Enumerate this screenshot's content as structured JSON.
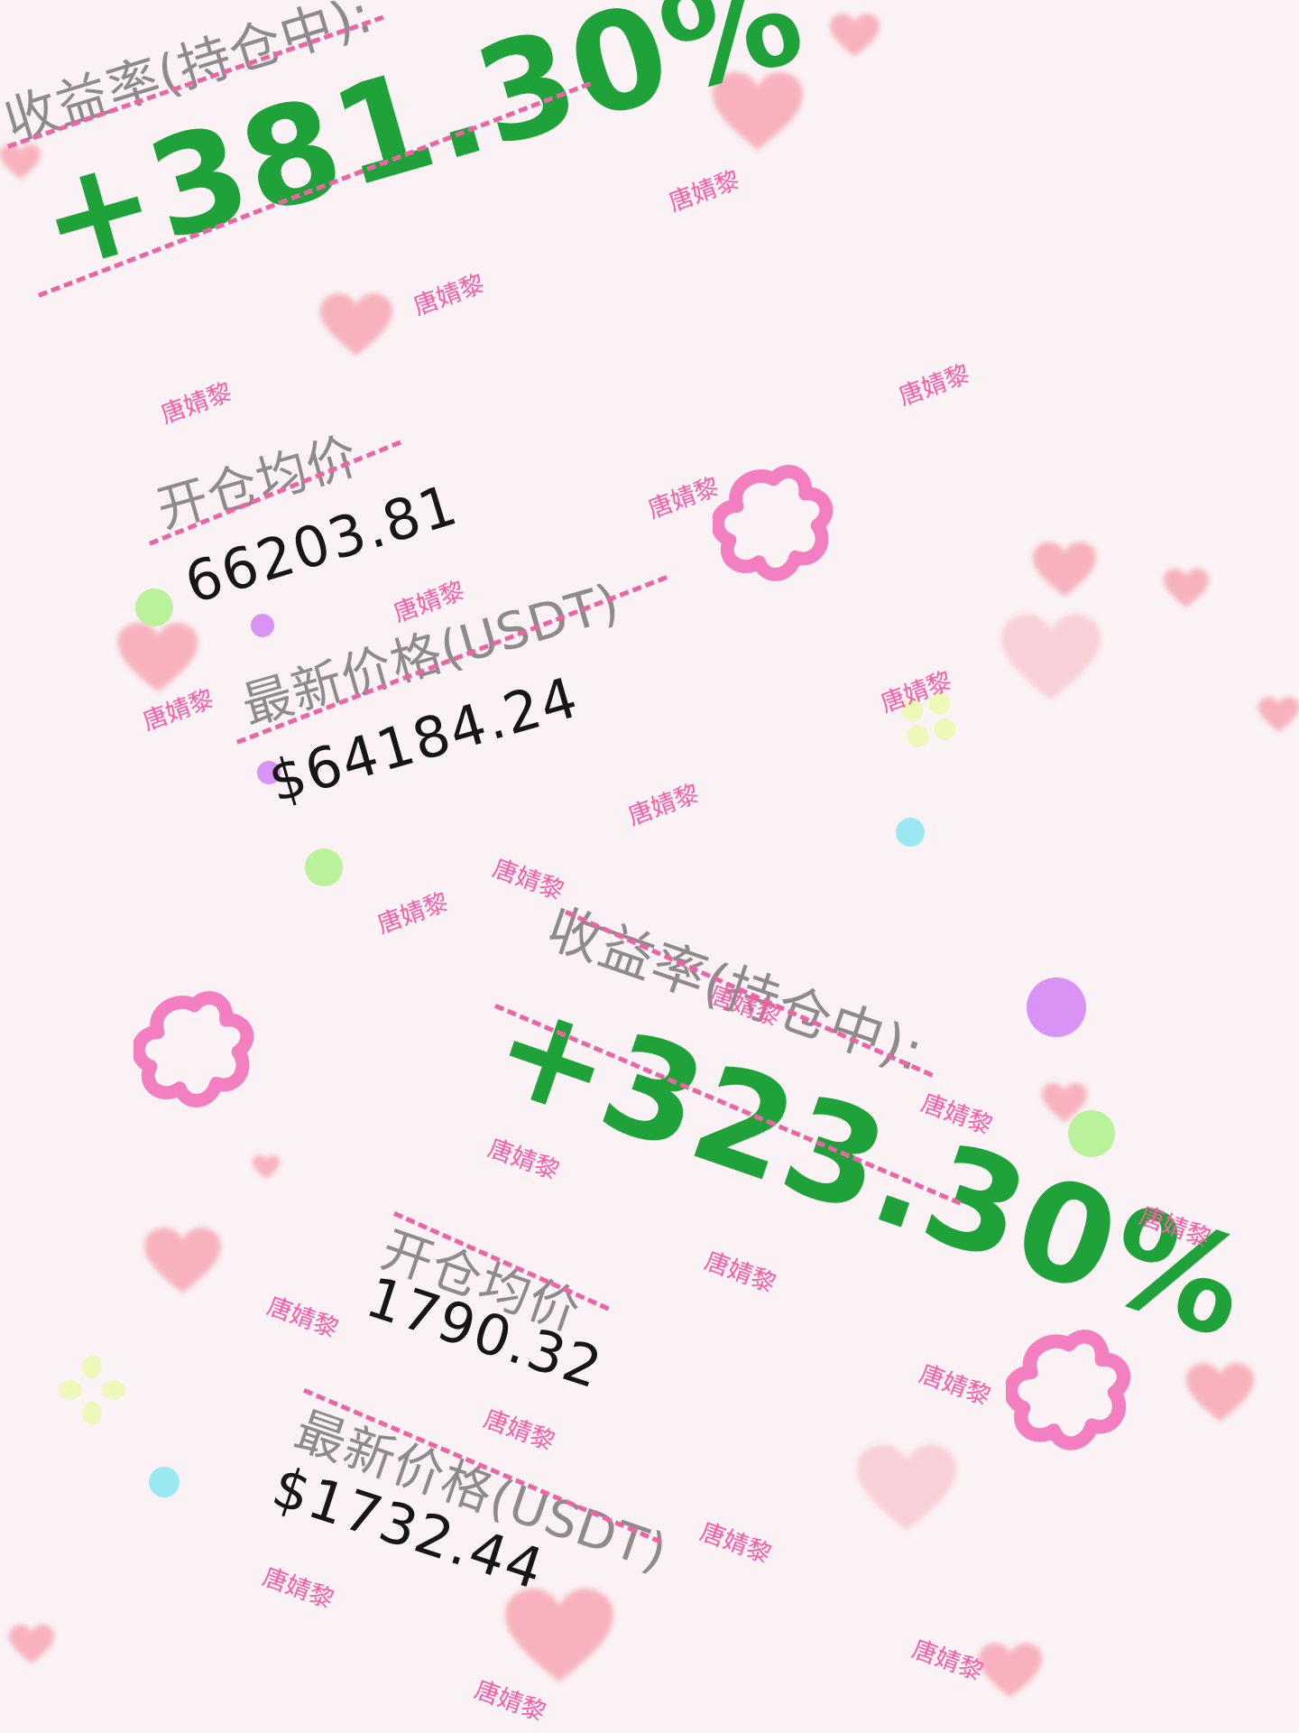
{
  "positions": [
    {
      "yield_label": "收益率(持仓中):",
      "yield_value": "+381.30%",
      "open_price_label": "开仓均价",
      "open_price_value": "66203.81",
      "latest_price_label": "最新价格(USDT)",
      "latest_price_value": "$64184.24"
    },
    {
      "yield_label": "收益率(持仓中):",
      "yield_value": "+323.30%",
      "open_price_label": "开仓均价",
      "open_price_value": "1790.32",
      "latest_price_label": "最新价格(USDT)",
      "latest_price_value": "$1732.44"
    }
  ],
  "watermark": "唐婧黎",
  "colors": {
    "background": "#faf2f4",
    "profit_green": "#1fa23a",
    "label_gray": "#8f8b8c",
    "value_black": "#161616",
    "strike_pink": "#ee63a4",
    "watermark_pink": "#ff5aa5",
    "flower_pink": "#f47fc0",
    "heart_pink": "#f7a8b4",
    "dot_green": "#b9f29a",
    "dot_purple": "#d893f5",
    "dot_cyan": "#9ae9f2",
    "clover_yellow": "#eef8b8"
  },
  "decorations": [
    "flower-icon",
    "heart-icon",
    "dot",
    "clover-icon"
  ]
}
